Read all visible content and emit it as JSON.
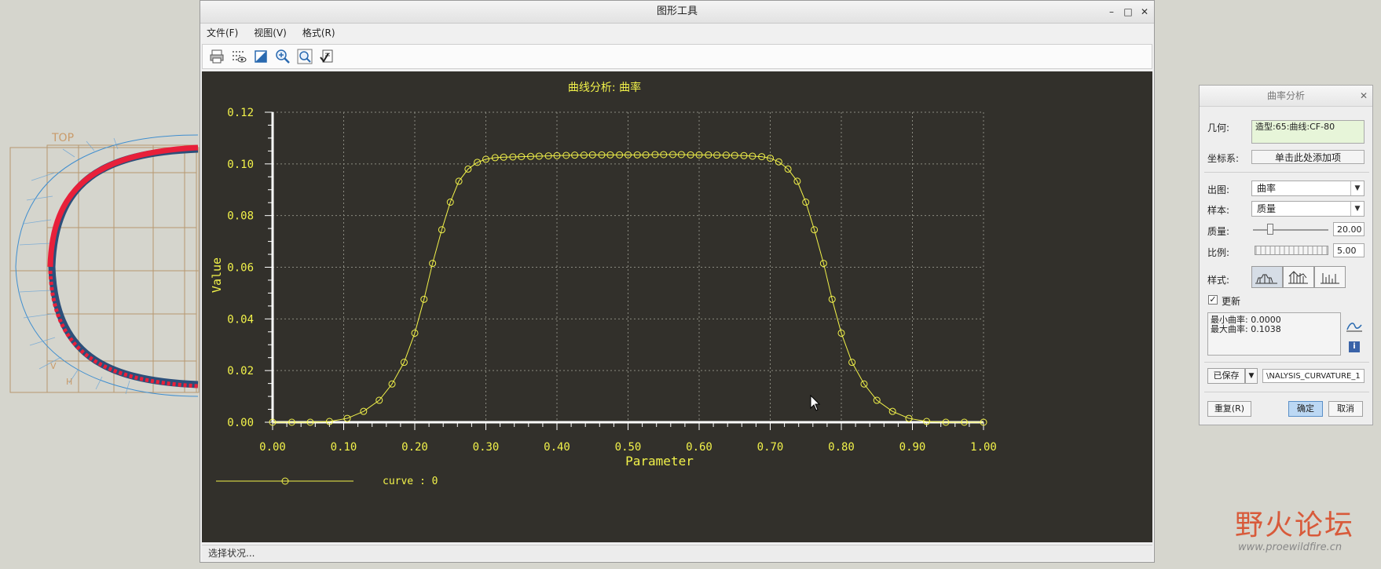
{
  "window": {
    "title": "图形工具",
    "menus": [
      "文件(F)",
      "视图(V)",
      "格式(R)"
    ],
    "status": "选择状况..."
  },
  "icons": [
    "printer-icon",
    "grid-icon",
    "box-icon",
    "zoom-in-icon",
    "refit-icon",
    "options-icon"
  ],
  "chart_data": {
    "type": "line",
    "title": "曲线分析:  曲率",
    "xlabel": "Parameter",
    "ylabel": "Value",
    "xlim": [
      0,
      1
    ],
    "ylim": [
      0,
      0.12
    ],
    "xticks": [
      "0.00",
      "0.10",
      "0.20",
      "0.30",
      "0.40",
      "0.50",
      "0.60",
      "0.70",
      "0.80",
      "0.90",
      "1.00"
    ],
    "yticks": [
      "0.00",
      "0.02",
      "0.04",
      "0.06",
      "0.08",
      "0.10",
      "0.12"
    ],
    "grid": true,
    "legend": "bottom-left",
    "colors": {
      "background": "#32302b",
      "line": "#f2f24a",
      "axis": "#ffffff",
      "grid": "#8a8a80"
    },
    "series": [
      {
        "name": "curve : 0",
        "x": [
          0.0,
          0.027,
          0.053,
          0.08,
          0.105,
          0.128,
          0.15,
          0.168,
          0.185,
          0.2,
          0.213,
          0.225,
          0.238,
          0.25,
          0.262,
          0.275,
          0.288,
          0.3,
          0.313,
          0.325,
          0.338,
          0.35,
          0.363,
          0.375,
          0.388,
          0.4,
          0.413,
          0.425,
          0.438,
          0.45,
          0.463,
          0.475,
          0.488,
          0.5,
          0.513,
          0.525,
          0.538,
          0.55,
          0.563,
          0.575,
          0.588,
          0.6,
          0.613,
          0.625,
          0.638,
          0.65,
          0.663,
          0.675,
          0.688,
          0.7,
          0.712,
          0.725,
          0.738,
          0.75,
          0.762,
          0.775,
          0.787,
          0.8,
          0.815,
          0.832,
          0.85,
          0.872,
          0.895,
          0.92,
          0.947,
          0.973,
          1.0
        ],
        "y": [
          0.0,
          0.0,
          0.0,
          0.0003,
          0.0015,
          0.0042,
          0.0085,
          0.0148,
          0.0232,
          0.0345,
          0.0476,
          0.0615,
          0.0745,
          0.0852,
          0.0933,
          0.098,
          0.1006,
          0.1018,
          0.1024,
          0.1026,
          0.1027,
          0.1028,
          0.1029,
          0.103,
          0.1031,
          0.1032,
          0.1033,
          0.1034,
          0.1034,
          0.1035,
          0.1035,
          0.1035,
          0.1035,
          0.1035,
          0.1035,
          0.1035,
          0.1036,
          0.1036,
          0.1036,
          0.1036,
          0.1035,
          0.1035,
          0.1035,
          0.1034,
          0.1034,
          0.1033,
          0.1032,
          0.103,
          0.1028,
          0.1022,
          0.1008,
          0.098,
          0.0933,
          0.0852,
          0.0745,
          0.0615,
          0.0476,
          0.0345,
          0.0232,
          0.0148,
          0.0085,
          0.0042,
          0.0015,
          0.0003,
          0.0,
          0.0,
          0.0
        ]
      }
    ]
  },
  "dialog": {
    "title": "曲率分析",
    "geometry_label": "几何:",
    "geometry_value": "造型:65:曲线:CF-80",
    "csys_label": "坐标系:",
    "csys_value": "单击此处添加项",
    "plot_label": "出图:",
    "plot_value": "曲率",
    "sample_label": "样本:",
    "sample_value": "质量",
    "quality_label": "质量:",
    "quality_value": "20.00",
    "quality_level": 0.2,
    "scale_label": "比例:",
    "scale_value": "5.00",
    "style_label": "样式:",
    "update_label": "更新",
    "update_checked": true,
    "min_label": "最小曲率:",
    "min_value": "0.0000",
    "max_label": "最大曲率:",
    "max_value": "0.1038",
    "saved_label": "已保存",
    "save_name": "\\NALYSIS_CURVATURE_1",
    "reset_label": "重复(R)",
    "ok_label": "确定",
    "cancel_label": "取消"
  },
  "viewport": {
    "view_label": "TOP"
  },
  "watermark": {
    "title": "野火论坛",
    "url": "www.proewildfire.cn"
  }
}
